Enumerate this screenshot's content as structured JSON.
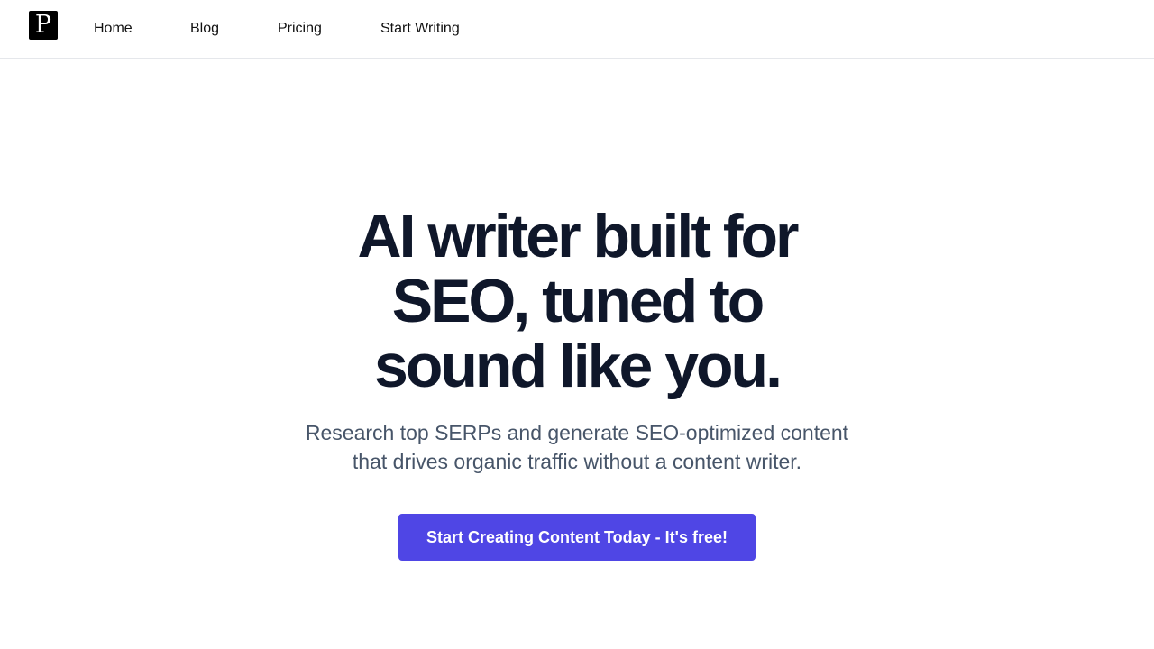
{
  "navbar": {
    "logo_letter": "P",
    "links": [
      {
        "label": "Home"
      },
      {
        "label": "Blog"
      },
      {
        "label": "Pricing"
      },
      {
        "label": "Start Writing"
      }
    ]
  },
  "hero": {
    "title_lines": [
      "AI writer built for",
      "SEO, tuned to",
      "sound like you."
    ],
    "subtitle_lines": [
      "Research top SERPs and generate SEO-optimized content",
      "that drives organic traffic without a content writer."
    ],
    "cta_label": "Start Creating Content Today - It's free!"
  },
  "colors": {
    "heading": "#0f172a",
    "subtitle": "#475569",
    "cta_background": "#4f46e5",
    "logo_background": "#000000"
  }
}
